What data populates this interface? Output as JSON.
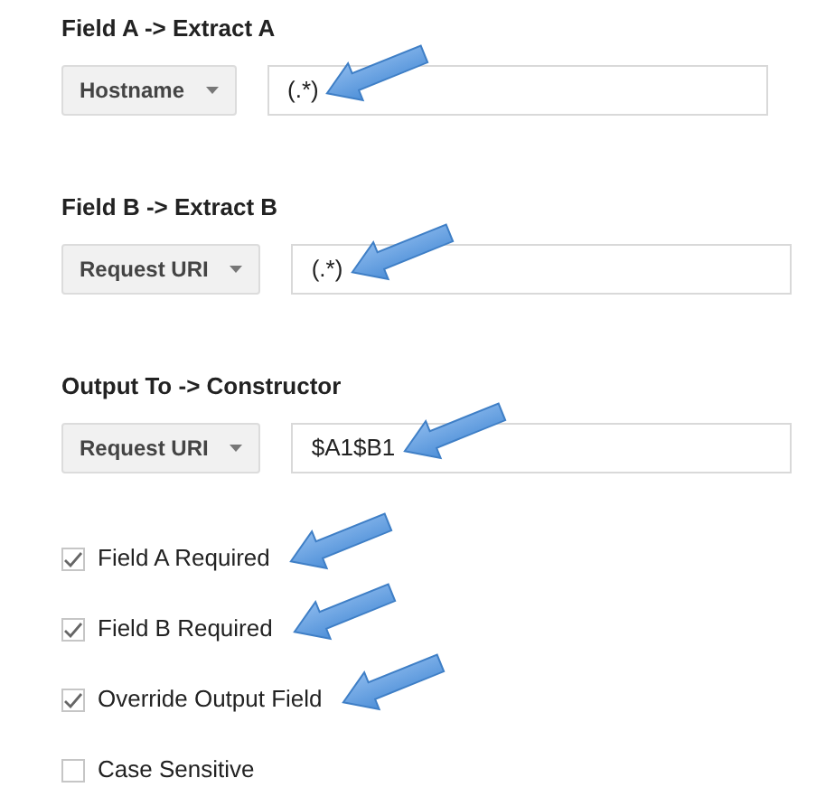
{
  "sections": [
    {
      "heading": "Field A -> Extract A",
      "dropdown": {
        "value": "Hostname"
      },
      "field": {
        "value": "(.*)",
        "annotated": true
      }
    },
    {
      "heading": "Field B -> Extract B",
      "dropdown": {
        "value": "Request URI"
      },
      "field": {
        "value": "(.*)",
        "annotated": true
      }
    },
    {
      "heading": "Output To -> Constructor",
      "dropdown": {
        "value": "Request URI"
      },
      "field": {
        "value": "$A1$B1",
        "annotated": true
      }
    }
  ],
  "checkboxes": [
    {
      "label": "Field A Required",
      "checked": true,
      "annotated": true
    },
    {
      "label": "Field B Required",
      "checked": true,
      "annotated": true
    },
    {
      "label": "Override Output Field",
      "checked": true,
      "annotated": true
    },
    {
      "label": "Case Sensitive",
      "checked": false,
      "annotated": false
    }
  ]
}
